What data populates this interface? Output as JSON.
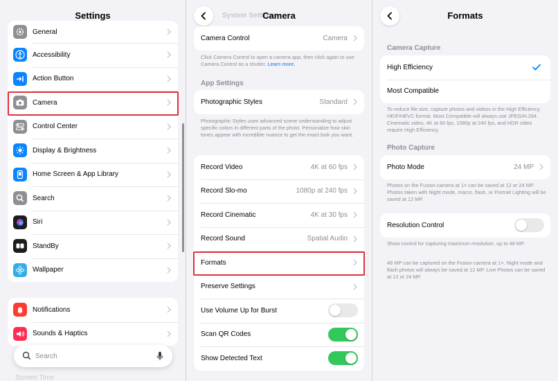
{
  "panel1": {
    "title": "Settings",
    "group1": [
      {
        "label": "General",
        "icon": "gear-icon",
        "color": "#8e8e93"
      },
      {
        "label": "Accessibility",
        "icon": "accessibility-icon",
        "color": "#0a84ff"
      },
      {
        "label": "Action Button",
        "icon": "action-button-icon",
        "color": "#0a84ff"
      },
      {
        "label": "Camera",
        "icon": "camera-icon",
        "color": "#8e8e93"
      },
      {
        "label": "Control Center",
        "icon": "control-center-icon",
        "color": "#8e8e93"
      },
      {
        "label": "Display & Brightness",
        "icon": "sun-icon",
        "color": "#0a84ff"
      },
      {
        "label": "Home Screen & App Library",
        "icon": "home-screen-icon",
        "color": "#0a84ff"
      },
      {
        "label": "Search",
        "icon": "search-icon",
        "color": "#8e8e93"
      },
      {
        "label": "Siri",
        "icon": "siri-icon",
        "color": "#1c1c1e"
      },
      {
        "label": "StandBy",
        "icon": "standby-icon",
        "color": "#1c1c1e"
      },
      {
        "label": "Wallpaper",
        "icon": "wallpaper-icon",
        "color": "#32ade6"
      }
    ],
    "group2": [
      {
        "label": "Notifications",
        "icon": "bell-icon",
        "color": "#ff3b30"
      },
      {
        "label": "Sounds & Haptics",
        "icon": "speaker-icon",
        "color": "#ff2d55"
      }
    ],
    "search_placeholder": "Search",
    "ghost_bottom": "Screen Time"
  },
  "panel2": {
    "title": "Camera",
    "ghost_title": "System Settings",
    "camera_control": {
      "label": "Camera Control",
      "value": "Camera"
    },
    "camera_control_footer": "Click Camera Control to open a camera app, then click again to use Camera Control as a shutter.",
    "learn_more": "Learn more.",
    "app_settings_header": "App Settings",
    "photographic_styles": {
      "label": "Photographic Styles",
      "value": "Standard"
    },
    "styles_footer": "Photographic Styles uses advanced scene understanding to adjust specific colors in different parts of the photo. Personalize how skin tones appear with incredible nuance to get the exact look you want.",
    "rows": [
      {
        "label": "Record Video",
        "value": "4K at 60 fps"
      },
      {
        "label": "Record Slo-mo",
        "value": "1080p at 240 fps"
      },
      {
        "label": "Record Cinematic",
        "value": "4K at 30 fps"
      },
      {
        "label": "Record Sound",
        "value": "Spatial Audio"
      },
      {
        "label": "Formats",
        "value": ""
      },
      {
        "label": "Preserve Settings",
        "value": ""
      }
    ],
    "toggles": [
      {
        "label": "Use Volume Up for Burst",
        "on": false
      },
      {
        "label": "Scan QR Codes",
        "on": true
      },
      {
        "label": "Show Detected Text",
        "on": true
      }
    ]
  },
  "panel3": {
    "title": "Formats",
    "camera_capture_header": "Camera Capture",
    "high_efficiency": "High Efficiency",
    "most_compatible": "Most Compatible",
    "capture_footer": "To reduce file size, capture photos and videos in the High Efficiency HEIF/HEVC format. Most Compatible will always use JPEG/H.264. Cinematic video, 4K at 60 fps, 1080p at 240 fps, and HDR video require High Efficiency.",
    "photo_capture_header": "Photo Capture",
    "photo_mode": {
      "label": "Photo Mode",
      "value": "24 MP"
    },
    "photo_mode_footer": "Photos on the Fusion camera at 1× can be saved at 12 or 24 MP. Photos taken with Night mode, macro, flash, or Portrait Lighting will be saved at 12 MP.",
    "resolution_control": {
      "label": "Resolution Control",
      "on": false
    },
    "resolution_footer1": "Show control for capturing maximum resolution, up to 48 MP.",
    "resolution_footer2": "48 MP can be captured on the Fusion camera at 1×. Night mode and flash photos will always be saved at 12 MP. Live Photos can be saved at 12 or 24 MP."
  },
  "colors": {
    "accent": "#007aff",
    "highlight": "#e0303d",
    "toggle_on": "#34c759"
  }
}
